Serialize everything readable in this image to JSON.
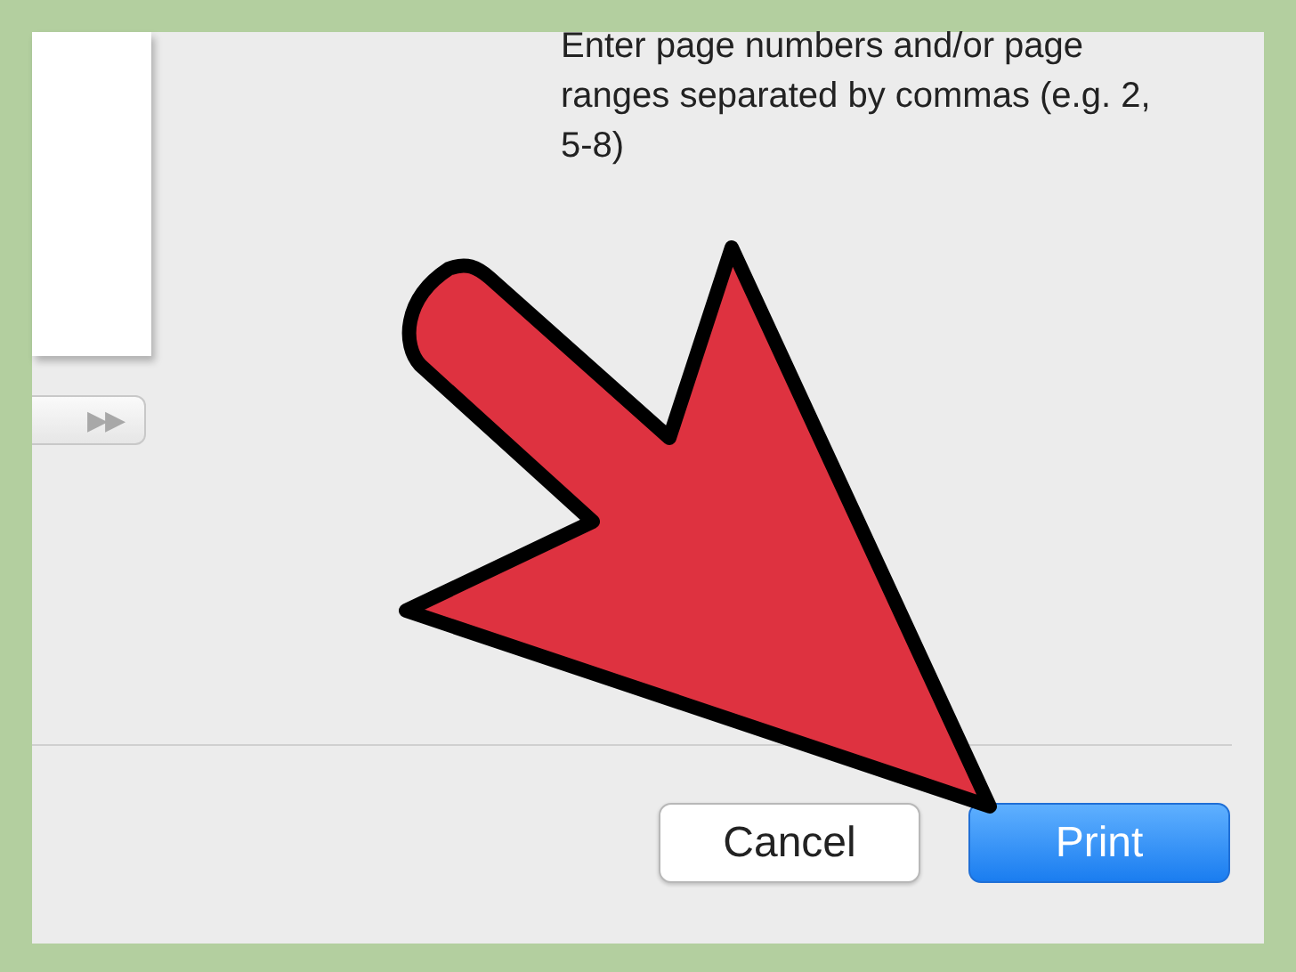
{
  "pages_hint": "Enter page numbers and/or page ranges separated by commas (e.g. 2, 5-8)",
  "page_nav_button": "▶▶",
  "buttons": [
    {
      "label": "Cancel",
      "kind": "secondary"
    },
    {
      "label": "Print",
      "kind": "default"
    }
  ]
}
